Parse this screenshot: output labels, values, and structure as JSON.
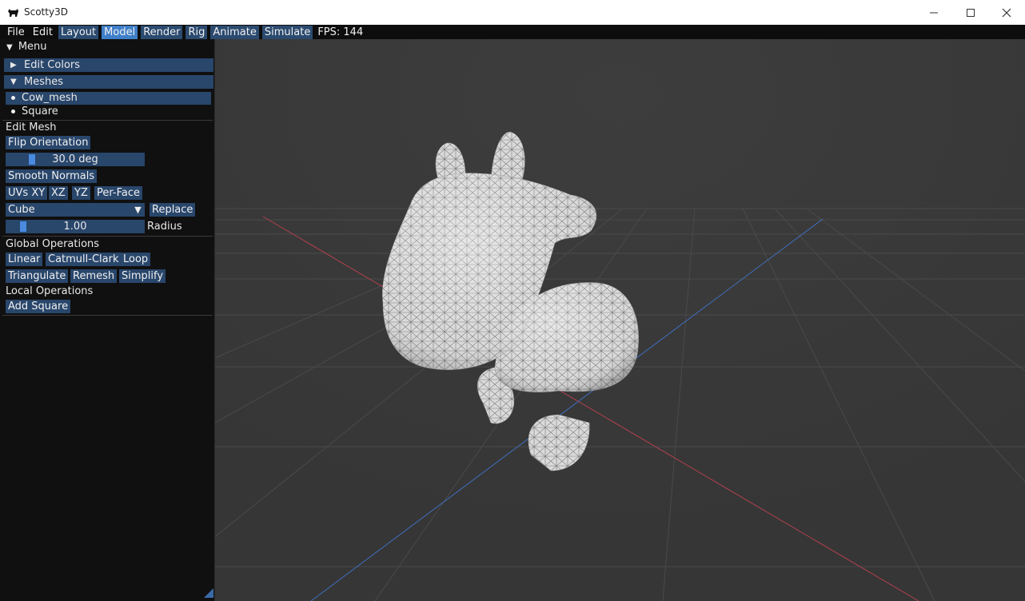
{
  "window": {
    "title": "Scotty3D"
  },
  "menubar": {
    "items": [
      {
        "label": "File",
        "style": "plain"
      },
      {
        "label": "Edit",
        "style": "plain"
      },
      {
        "label": "Layout",
        "style": "boxed"
      },
      {
        "label": "Model",
        "style": "active"
      },
      {
        "label": "Render",
        "style": "boxed"
      },
      {
        "label": "Rig",
        "style": "boxed"
      },
      {
        "label": "Animate",
        "style": "boxed"
      },
      {
        "label": "Simulate",
        "style": "boxed"
      }
    ],
    "fps": "FPS: 144"
  },
  "panel": {
    "menu_header": "Menu",
    "edit_colors": "Edit Colors",
    "meshes": "Meshes",
    "mesh_items": [
      "Cow_mesh",
      "Square"
    ],
    "edit_mesh": "Edit Mesh",
    "flip_orientation": "Flip Orientation",
    "angle_value": "30.0 deg",
    "smooth_normals": "Smooth Normals",
    "uv_buttons": [
      "UVs XY",
      "XZ",
      "YZ",
      "Per-Face"
    ],
    "shape_select": "Cube",
    "replace": "Replace",
    "radius_value": "1.00",
    "radius_label": "Radius",
    "global_ops": "Global Operations",
    "global_buttons_row1": [
      "Linear",
      "Catmull-Clark",
      "Loop"
    ],
    "global_buttons_row2": [
      "Triangulate",
      "Remesh",
      "Simplify"
    ],
    "local_ops": "Local Operations",
    "add_square": "Add Square"
  },
  "colors": {
    "accent_active": "#3f7fc9",
    "button_bg": "#29466b",
    "x_axis": "#b0404f",
    "z_axis": "#3f6fbf"
  }
}
